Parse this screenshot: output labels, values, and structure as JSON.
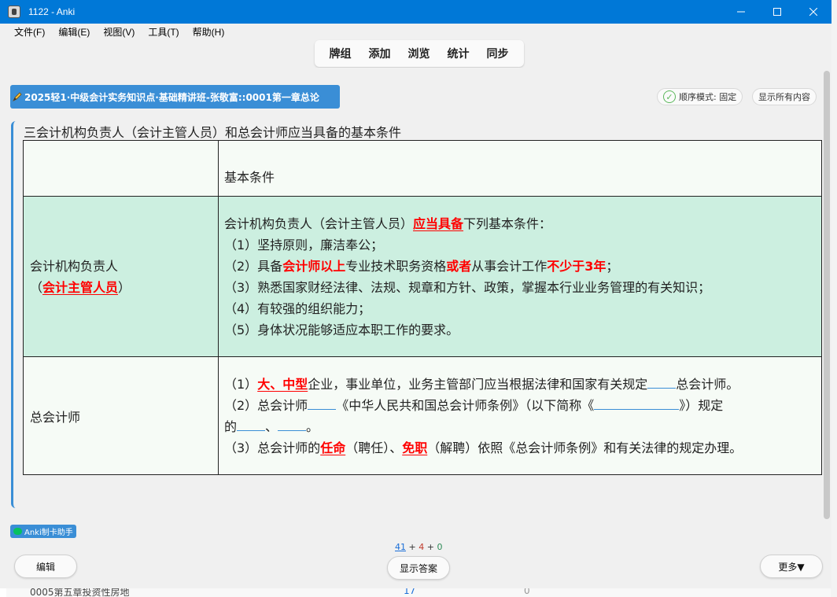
{
  "window": {
    "title": "1122 - Anki"
  },
  "menu": [
    "文件(F)",
    "编辑(E)",
    "视图(V)",
    "工具(T)",
    "帮助(H)"
  ],
  "toolbar": [
    "牌组",
    "添加",
    "浏览",
    "统计",
    "同步"
  ],
  "deck": {
    "name": "2025轻1·中级会计实务知识点·基础精讲班-张敬富::0001第一章总论"
  },
  "mode_pill": {
    "label": "顺序模式: 固定"
  },
  "show_all_pill": {
    "label": "显示所有内容"
  },
  "card": {
    "heading": "三会计机构负责人（会计主管人员）和总会计师应当具备的基本条件",
    "header_cell": "基本条件",
    "row_a": {
      "label_line1": "会计机构负责人",
      "label_line2_pre": "（",
      "label_line2_red": "会计主管人员",
      "label_line2_post": "）",
      "intro_pre": "会计机构负责人（会计主管人员）",
      "intro_red": "应当具备",
      "intro_post": "下列基本条件：",
      "item1": "（1）坚持原则，廉洁奉公；",
      "item2_a": "（2）具备",
      "item2_red1": "会计师以上",
      "item2_b": "专业技术职务资格",
      "item2_red2": "或者",
      "item2_c": "从事会计工作",
      "item2_red3": "不少于3年",
      "item2_d": "；",
      "item3": "（3）熟悉国家财经法律、法规、规章和方针、政策，掌握本行业业务管理的有关知识；",
      "item4": "（4）有较强的组织能力；",
      "item5": "（5）身体状况能够适应本职工作的要求。"
    },
    "row_b": {
      "label": "总会计师",
      "line1_a": "（1）",
      "line1_red": "大、中型",
      "line1_b": "企业，事业单位，业务主管部门应当根据法律和国家有关规定",
      "line1_c": "总会计师。",
      "line2_a": "（2）总会计师",
      "line2_b": "《中华人民共和国总会计师条例》（以下简称《",
      "line2_c": "》）规定",
      "line3_a": "的",
      "line3_b": "、",
      "line3_c": "。",
      "line4_a": "（3）总会计师的",
      "line4_red1": "任命",
      "line4_b": "（聘任）、",
      "line4_red2": "免职",
      "line4_c": "（解聘）依照《总会计师条例》和有关法律的规定办理。"
    }
  },
  "helper": {
    "label": "Anki制卡助手"
  },
  "counts": {
    "new": "41",
    "learn": "4",
    "review": "0",
    "plus": "+"
  },
  "bottom": {
    "edit": "编辑",
    "show_answer": "显示答案",
    "more": "更多▼"
  },
  "background": {
    "deck_row": "0005第五章投资性房地",
    "count1": "17",
    "count2": "0"
  },
  "colors": {
    "title_bar": "#0078d7",
    "accent": "#3a8ed6",
    "row_highlight": "#ccefe0",
    "emphasis": "#ff0000"
  }
}
